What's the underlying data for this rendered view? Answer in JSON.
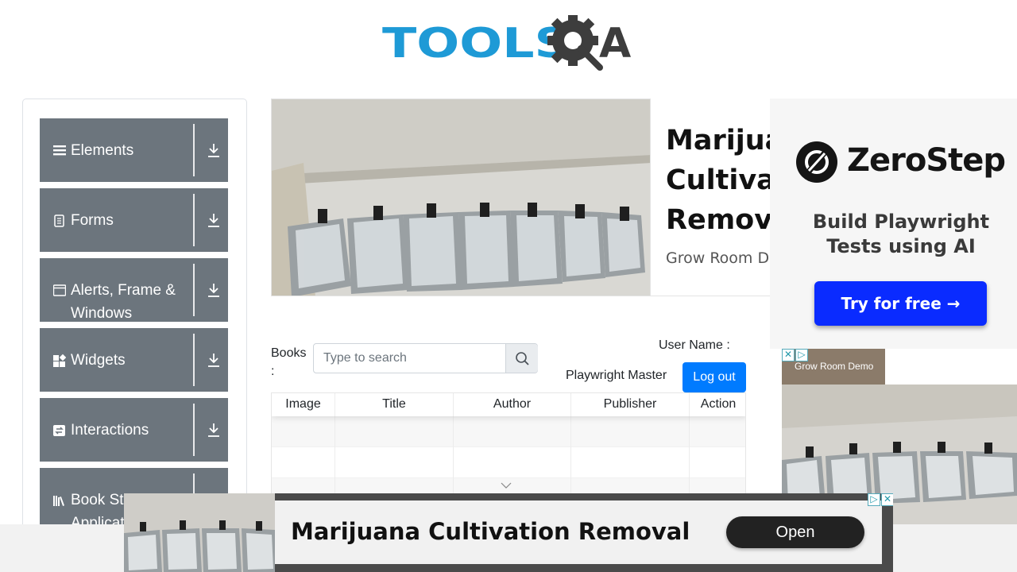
{
  "brand": {
    "logo_text": "TOOLS",
    "logo_letter": "A"
  },
  "sidebar": {
    "items": [
      {
        "label": "Elements",
        "icon": "hamburger-icon"
      },
      {
        "label": "Forms",
        "icon": "document-icon"
      },
      {
        "label": "Alerts, Frame & Windows",
        "icon": "window-icon"
      },
      {
        "label": "Widgets",
        "icon": "widgets-icon"
      },
      {
        "label": "Interactions",
        "icon": "swap-icon"
      },
      {
        "label": "Book Store Application",
        "icon": "books-icon"
      }
    ]
  },
  "hero": {
    "title_lines": [
      "Marijuan",
      "Cultivati",
      "Remova"
    ],
    "subtitle": "Grow Room De"
  },
  "books": {
    "label": "Books :",
    "search_placeholder": "Type to search",
    "search_icon": "search-icon"
  },
  "user": {
    "label": "User Name :",
    "value": "Playwright Master",
    "logout_label": "Log out"
  },
  "table": {
    "columns": [
      "Image",
      "Title",
      "Author",
      "Publisher",
      "Action"
    ],
    "rows": [
      [
        "",
        "",
        "",
        "",
        ""
      ],
      [
        "",
        "",
        "",
        "",
        ""
      ],
      [
        "",
        "",
        "",
        "",
        ""
      ]
    ]
  },
  "ad_right": {
    "brand": "ZeroStep",
    "tagline": "Build Playwright Tests using AI",
    "cta": "Try for free →",
    "cta_color": "#0a2bff"
  },
  "ad_right_2": {
    "tab_label": "Grow Room Demo"
  },
  "ad_bottom": {
    "title": "Marijuana Cultivation Removal",
    "button": "Open"
  },
  "colors": {
    "sidebar_group_bg": "#6c757d",
    "primary_button": "#007bff",
    "logo_blue": "#1e9ad6",
    "logo_dark": "#3d3d3d"
  }
}
